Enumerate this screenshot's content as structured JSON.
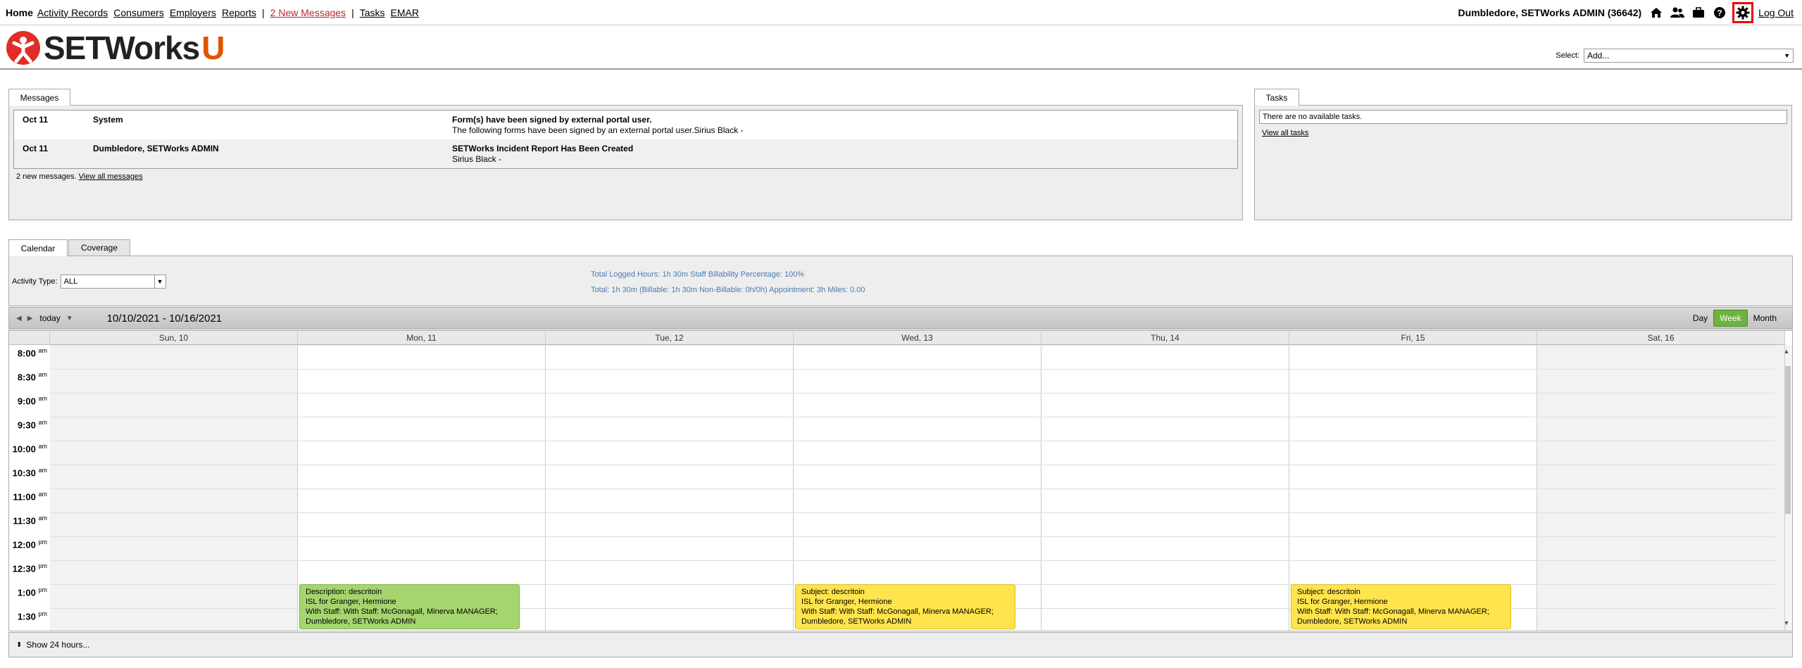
{
  "topnav": {
    "home": "Home",
    "links": [
      "Activity Records",
      "Consumers",
      "Employers",
      "Reports"
    ],
    "messages_link": "2 New Messages",
    "links2": [
      "Tasks",
      "EMAR"
    ],
    "user": "Dumbledore, SETWorks ADMIN",
    "user_id": "(36642)",
    "logout": "Log Out"
  },
  "header": {
    "logo_text": "SETWorks",
    "logo_suffix": "U",
    "select_label": "Select:",
    "select_value": "Add..."
  },
  "messages": {
    "tab": "Messages",
    "rows": [
      {
        "date": "Oct 11",
        "from": "System",
        "subject": "Form(s) have been signed by external portal user.",
        "preview": "The following forms have been signed by an external portal user.Sirius Black -"
      },
      {
        "date": "Oct 11",
        "from": "Dumbledore, SETWorks ADMIN",
        "subject": "SETWorks Incident Report Has Been Created",
        "preview": "Sirius Black -"
      }
    ],
    "footer_text": "2 new messages.",
    "footer_link": "View all messages"
  },
  "tasks": {
    "tab": "Tasks",
    "empty": "There are no available tasks.",
    "link": "View all tasks"
  },
  "calendar": {
    "tabs": [
      "Calendar",
      "Coverage"
    ],
    "activity_type_label": "Activity Type:",
    "activity_type_value": "ALL",
    "stats_line1": "Total Logged Hours: 1h 30m   Staff Billability Percentage: 100%",
    "stats_line2": "Total: 1h 30m   (Billable: 1h 30m   Non-Billable: 0h/0h)   Appointment: 3h   Miles: 0.00",
    "today": "today",
    "range": "10/10/2021 - 10/16/2021",
    "views": [
      "Day",
      "Week",
      "Month"
    ],
    "active_view": "Week",
    "days": [
      "Sun, 10",
      "Mon, 11",
      "Tue, 12",
      "Wed, 13",
      "Thu, 14",
      "Fri, 15",
      "Sat, 16"
    ],
    "times": [
      {
        "t": "8:00",
        "ap": "am"
      },
      {
        "t": "8:30",
        "ap": "am"
      },
      {
        "t": "9:00",
        "ap": "am"
      },
      {
        "t": "9:30",
        "ap": "am"
      },
      {
        "t": "10:00",
        "ap": "am"
      },
      {
        "t": "10:30",
        "ap": "am"
      },
      {
        "t": "11:00",
        "ap": "am"
      },
      {
        "t": "11:30",
        "ap": "am"
      },
      {
        "t": "12:00",
        "ap": "pm"
      },
      {
        "t": "12:30",
        "ap": "pm"
      },
      {
        "t": "1:00",
        "ap": "pm"
      },
      {
        "t": "1:30",
        "ap": "pm"
      }
    ],
    "events": [
      {
        "day": 1,
        "color": "green",
        "lines": [
          "Description: descritoin",
          "ISL for Granger, Hermione",
          "With Staff: With Staff: McGonagall, Minerva MANAGER;",
          "Dumbledore, SETWorks ADMIN"
        ]
      },
      {
        "day": 3,
        "color": "yellow",
        "lines": [
          "Subject: descritoin",
          "ISL for Granger, Hermione",
          "With Staff: With Staff: McGonagall, Minerva MANAGER;",
          "Dumbledore, SETWorks ADMIN"
        ]
      },
      {
        "day": 5,
        "color": "yellow",
        "lines": [
          "Subject: descritoin",
          "ISL for Granger, Hermione",
          "With Staff: With Staff: McGonagall, Minerva MANAGER;",
          "Dumbledore, SETWorks ADMIN"
        ]
      }
    ],
    "show_24": "Show 24 hours..."
  },
  "colors": {
    "accent_red": "#c0262c",
    "logo_orange": "#e35205",
    "week_active": "#6db33f",
    "event_green": "#a5d56e",
    "event_yellow": "#ffe44d",
    "stats_blue": "#4a7ab0"
  }
}
